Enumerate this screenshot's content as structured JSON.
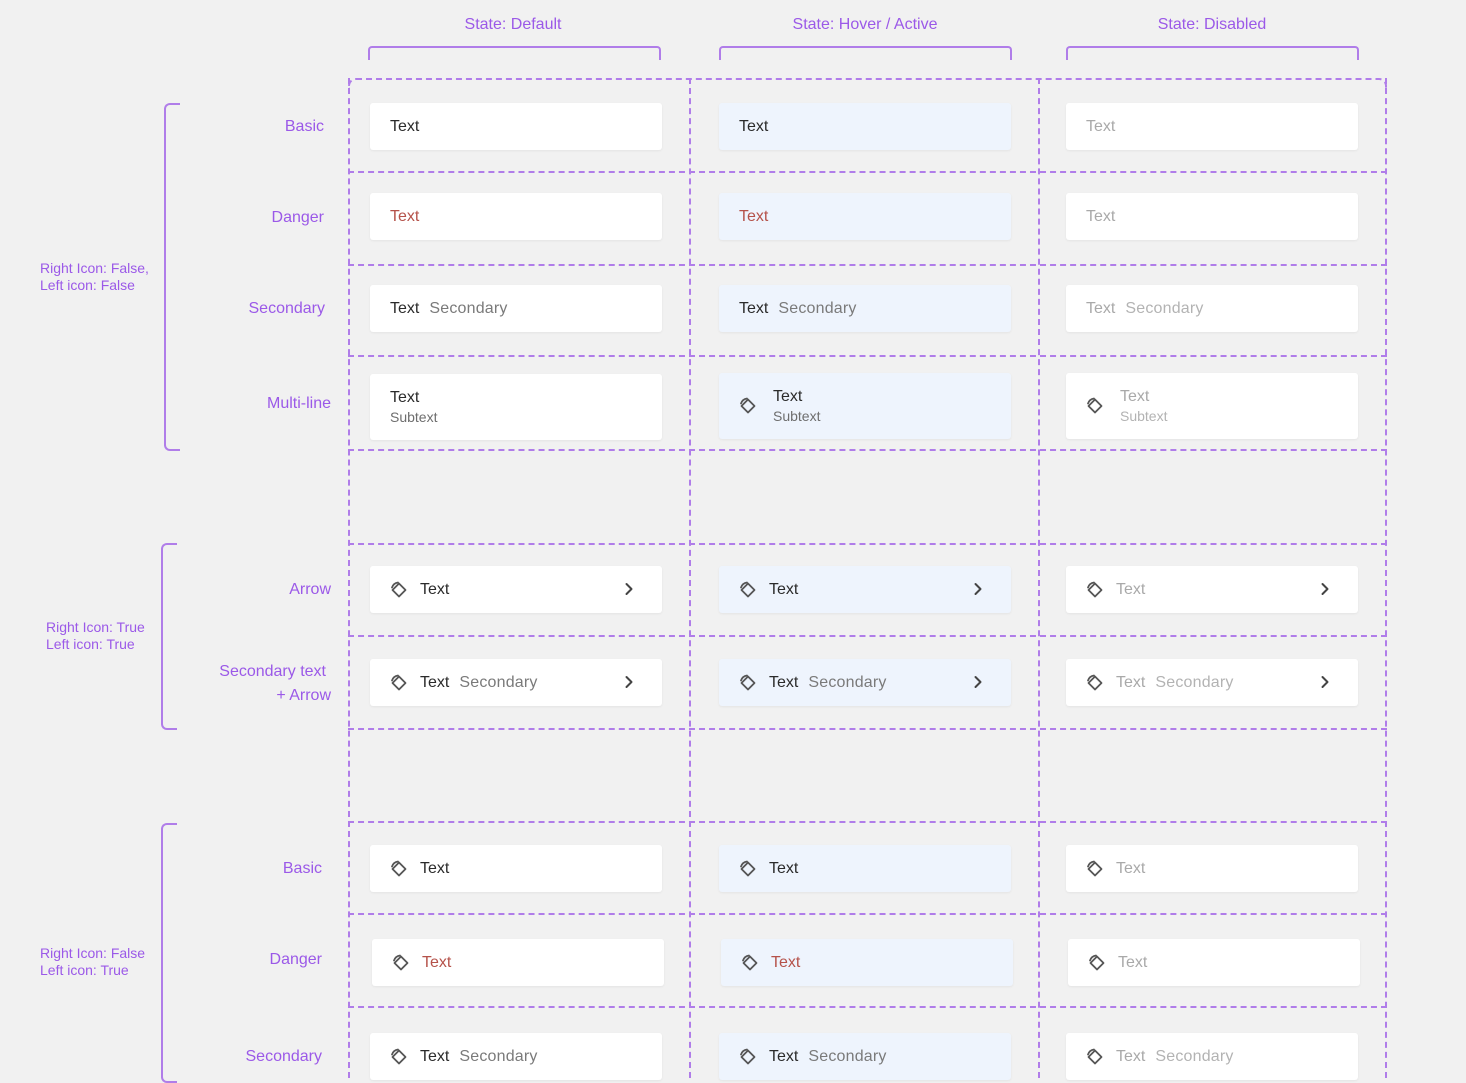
{
  "columns": {
    "default": "State: Default",
    "hover": "State: Hover / Active",
    "disabled": "State: Disabled"
  },
  "groups": {
    "g1": "Right Icon: False,\nLeft icon: False",
    "g1_line1": "Right Icon: False,",
    "g1_line2": "Left icon: False",
    "g2_line1": "Right Icon: True",
    "g2_line2": "Left icon: True",
    "g3_line1": "Right Icon: False",
    "g3_line2": "Left icon: True"
  },
  "rows": {
    "basic": "Basic",
    "danger": "Danger",
    "secondary": "Secondary",
    "multiline": "Multi-line",
    "arrow": "Arrow",
    "sec_arrow_1": "Secondary text",
    "sec_arrow_2": "+ Arrow",
    "basic2": "Basic",
    "danger2": "Danger",
    "secondary2": "Secondary"
  },
  "cell": {
    "text": "Text",
    "secondary": "Secondary",
    "subtext": "Subtext"
  },
  "icons": {
    "left": "rotate-diamond-icon",
    "right": "chevron-right-icon"
  },
  "colors": {
    "accent": "#9b59e8",
    "hover_bg": "#eef4fd",
    "danger": "#b5524a",
    "disabled_text": "#a9a9a9"
  }
}
